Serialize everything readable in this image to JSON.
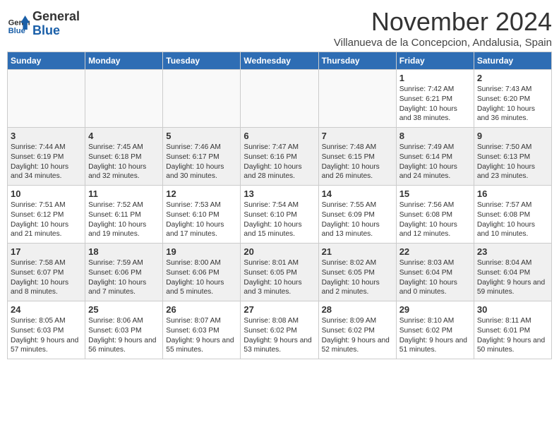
{
  "logo": {
    "line1": "General",
    "line2": "Blue"
  },
  "title": "November 2024",
  "location": "Villanueva de la Concepcion, Andalusia, Spain",
  "days_of_week": [
    "Sunday",
    "Monday",
    "Tuesday",
    "Wednesday",
    "Thursday",
    "Friday",
    "Saturday"
  ],
  "weeks": [
    [
      {
        "day": "",
        "text": ""
      },
      {
        "day": "",
        "text": ""
      },
      {
        "day": "",
        "text": ""
      },
      {
        "day": "",
        "text": ""
      },
      {
        "day": "",
        "text": ""
      },
      {
        "day": "1",
        "text": "Sunrise: 7:42 AM\nSunset: 6:21 PM\nDaylight: 10 hours and 38 minutes."
      },
      {
        "day": "2",
        "text": "Sunrise: 7:43 AM\nSunset: 6:20 PM\nDaylight: 10 hours and 36 minutes."
      }
    ],
    [
      {
        "day": "3",
        "text": "Sunrise: 7:44 AM\nSunset: 6:19 PM\nDaylight: 10 hours and 34 minutes."
      },
      {
        "day": "4",
        "text": "Sunrise: 7:45 AM\nSunset: 6:18 PM\nDaylight: 10 hours and 32 minutes."
      },
      {
        "day": "5",
        "text": "Sunrise: 7:46 AM\nSunset: 6:17 PM\nDaylight: 10 hours and 30 minutes."
      },
      {
        "day": "6",
        "text": "Sunrise: 7:47 AM\nSunset: 6:16 PM\nDaylight: 10 hours and 28 minutes."
      },
      {
        "day": "7",
        "text": "Sunrise: 7:48 AM\nSunset: 6:15 PM\nDaylight: 10 hours and 26 minutes."
      },
      {
        "day": "8",
        "text": "Sunrise: 7:49 AM\nSunset: 6:14 PM\nDaylight: 10 hours and 24 minutes."
      },
      {
        "day": "9",
        "text": "Sunrise: 7:50 AM\nSunset: 6:13 PM\nDaylight: 10 hours and 23 minutes."
      }
    ],
    [
      {
        "day": "10",
        "text": "Sunrise: 7:51 AM\nSunset: 6:12 PM\nDaylight: 10 hours and 21 minutes."
      },
      {
        "day": "11",
        "text": "Sunrise: 7:52 AM\nSunset: 6:11 PM\nDaylight: 10 hours and 19 minutes."
      },
      {
        "day": "12",
        "text": "Sunrise: 7:53 AM\nSunset: 6:10 PM\nDaylight: 10 hours and 17 minutes."
      },
      {
        "day": "13",
        "text": "Sunrise: 7:54 AM\nSunset: 6:10 PM\nDaylight: 10 hours and 15 minutes."
      },
      {
        "day": "14",
        "text": "Sunrise: 7:55 AM\nSunset: 6:09 PM\nDaylight: 10 hours and 13 minutes."
      },
      {
        "day": "15",
        "text": "Sunrise: 7:56 AM\nSunset: 6:08 PM\nDaylight: 10 hours and 12 minutes."
      },
      {
        "day": "16",
        "text": "Sunrise: 7:57 AM\nSunset: 6:08 PM\nDaylight: 10 hours and 10 minutes."
      }
    ],
    [
      {
        "day": "17",
        "text": "Sunrise: 7:58 AM\nSunset: 6:07 PM\nDaylight: 10 hours and 8 minutes."
      },
      {
        "day": "18",
        "text": "Sunrise: 7:59 AM\nSunset: 6:06 PM\nDaylight: 10 hours and 7 minutes."
      },
      {
        "day": "19",
        "text": "Sunrise: 8:00 AM\nSunset: 6:06 PM\nDaylight: 10 hours and 5 minutes."
      },
      {
        "day": "20",
        "text": "Sunrise: 8:01 AM\nSunset: 6:05 PM\nDaylight: 10 hours and 3 minutes."
      },
      {
        "day": "21",
        "text": "Sunrise: 8:02 AM\nSunset: 6:05 PM\nDaylight: 10 hours and 2 minutes."
      },
      {
        "day": "22",
        "text": "Sunrise: 8:03 AM\nSunset: 6:04 PM\nDaylight: 10 hours and 0 minutes."
      },
      {
        "day": "23",
        "text": "Sunrise: 8:04 AM\nSunset: 6:04 PM\nDaylight: 9 hours and 59 minutes."
      }
    ],
    [
      {
        "day": "24",
        "text": "Sunrise: 8:05 AM\nSunset: 6:03 PM\nDaylight: 9 hours and 57 minutes."
      },
      {
        "day": "25",
        "text": "Sunrise: 8:06 AM\nSunset: 6:03 PM\nDaylight: 9 hours and 56 minutes."
      },
      {
        "day": "26",
        "text": "Sunrise: 8:07 AM\nSunset: 6:03 PM\nDaylight: 9 hours and 55 minutes."
      },
      {
        "day": "27",
        "text": "Sunrise: 8:08 AM\nSunset: 6:02 PM\nDaylight: 9 hours and 53 minutes."
      },
      {
        "day": "28",
        "text": "Sunrise: 8:09 AM\nSunset: 6:02 PM\nDaylight: 9 hours and 52 minutes."
      },
      {
        "day": "29",
        "text": "Sunrise: 8:10 AM\nSunset: 6:02 PM\nDaylight: 9 hours and 51 minutes."
      },
      {
        "day": "30",
        "text": "Sunrise: 8:11 AM\nSunset: 6:01 PM\nDaylight: 9 hours and 50 minutes."
      }
    ]
  ]
}
